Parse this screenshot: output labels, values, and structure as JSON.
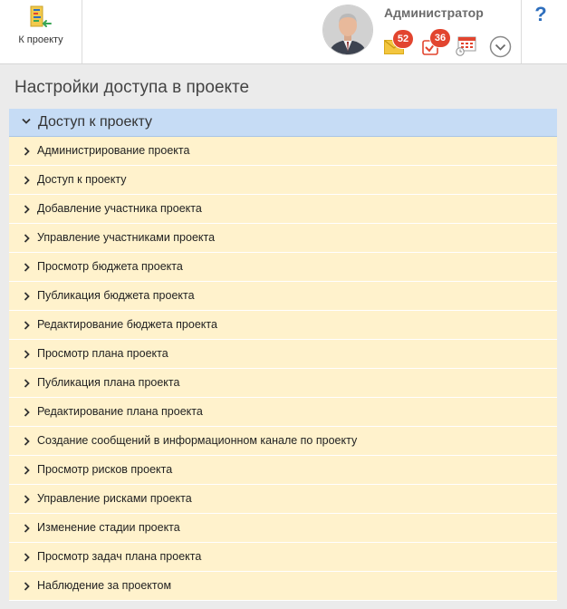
{
  "toolbar": {
    "back_label": "К проекту"
  },
  "user": {
    "name": "Администратор"
  },
  "notifications": {
    "messages_count": "52",
    "tasks_count": "36"
  },
  "help": {
    "label": "?"
  },
  "page": {
    "title": "Настройки доступа в проекте"
  },
  "group": {
    "title": "Доступ к проекту",
    "items": [
      {
        "label": "Администрирование проекта"
      },
      {
        "label": "Доступ к проекту"
      },
      {
        "label": "Добавление участника проекта"
      },
      {
        "label": "Управление участниками проекта"
      },
      {
        "label": "Просмотр бюджета проекта"
      },
      {
        "label": "Публикация бюджета проекта"
      },
      {
        "label": "Редактирование бюджета проекта"
      },
      {
        "label": "Просмотр плана проекта"
      },
      {
        "label": "Публикация плана проекта"
      },
      {
        "label": "Редактирование плана проекта"
      },
      {
        "label": "Создание сообщений в информационном канале по проекту"
      },
      {
        "label": "Просмотр рисков проекта"
      },
      {
        "label": "Управление рисками проекта"
      },
      {
        "label": "Изменение стадии проекта"
      },
      {
        "label": "Просмотр задач плана проекта"
      },
      {
        "label": "Наблюдение за проектом"
      }
    ]
  },
  "icons": {
    "back": "project-chart-icon",
    "messages": "envelope-icon",
    "tasks": "task-check-icon",
    "calendar": "calendar-icon",
    "menu": "chevron-down-circle-icon"
  },
  "colors": {
    "group_header_bg": "#c6dcf5",
    "item_bg": "#fff2cc",
    "badge": "#e2452f",
    "help": "#2f6fbd"
  }
}
